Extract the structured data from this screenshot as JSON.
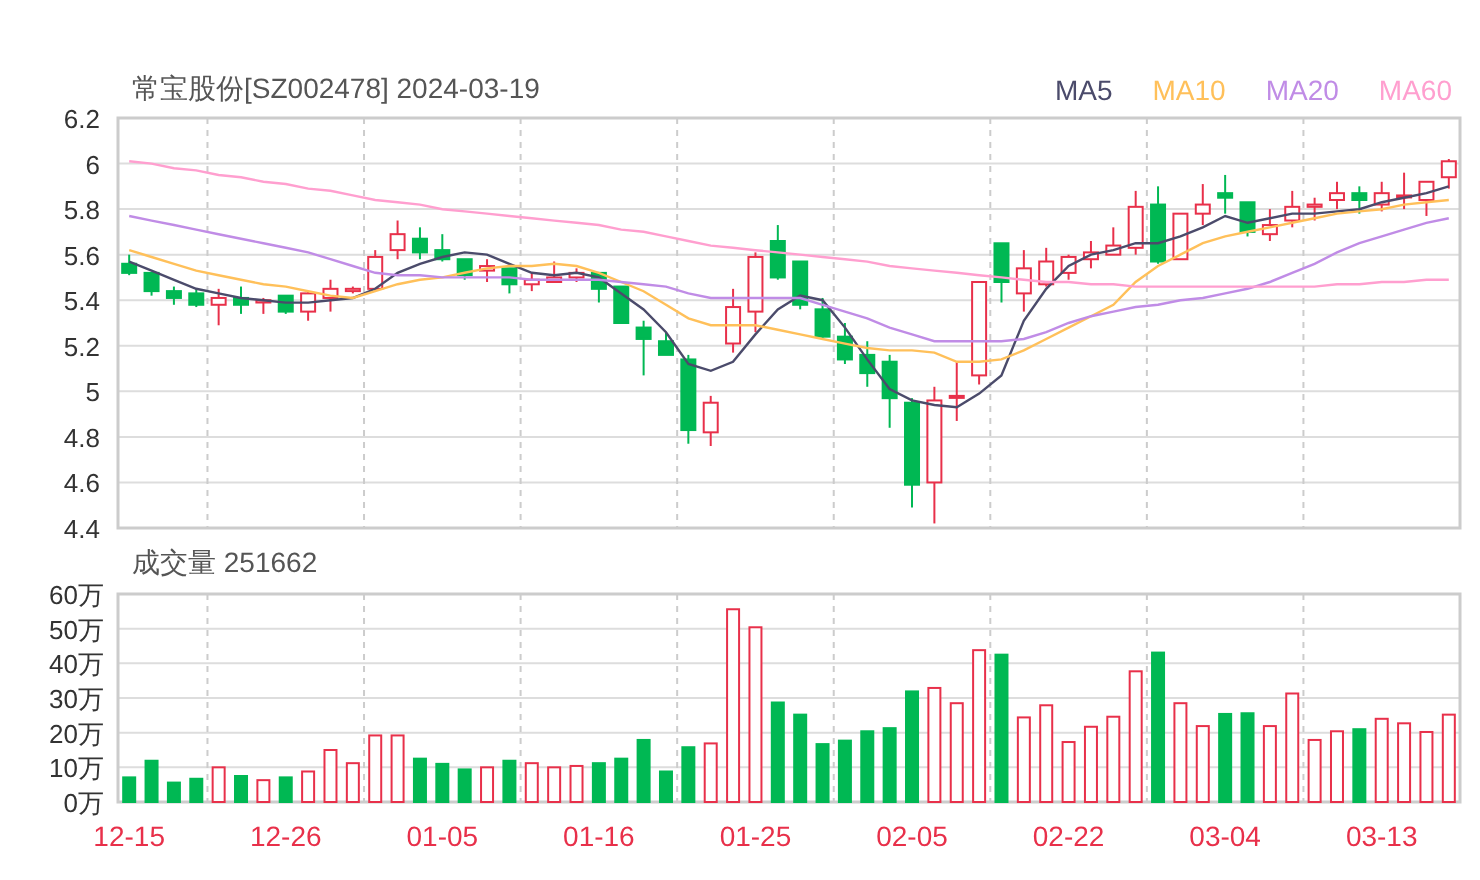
{
  "title": "常宝股份[SZ002478] 2024-03-19",
  "price_chart": {
    "chart_data": {
      "type": "candlestick",
      "grid": true,
      "ylim": [
        4.4,
        6.2
      ],
      "yticks": [
        4.4,
        4.6,
        4.8,
        5,
        5.2,
        5.4,
        5.6,
        5.8,
        6,
        6.2
      ],
      "categories": [
        null,
        null,
        null,
        null,
        null,
        null,
        null,
        null,
        null,
        null,
        null,
        null,
        null,
        null,
        null,
        null,
        null,
        null,
        null,
        null,
        null,
        null,
        null,
        null,
        null,
        null,
        null,
        null,
        null,
        null,
        null,
        null,
        null,
        null,
        null,
        null,
        null,
        null,
        null,
        null,
        null,
        null,
        null,
        null,
        null,
        null,
        null,
        null,
        null,
        null,
        null,
        null,
        null,
        null,
        null,
        null,
        null,
        null,
        null,
        null
      ],
      "series": [
        {
          "name": "MA5",
          "type": "line",
          "color": "#4b4b6b",
          "values": [
            5.57,
            5.53,
            5.49,
            5.45,
            5.43,
            5.41,
            5.4,
            5.39,
            5.39,
            5.4,
            5.41,
            5.45,
            5.52,
            5.56,
            5.59,
            5.61,
            5.6,
            5.56,
            5.52,
            5.51,
            5.52,
            5.5,
            5.43,
            5.36,
            5.26,
            5.12,
            5.09,
            5.13,
            5.25,
            5.36,
            5.42,
            5.4,
            5.28,
            5.14,
            5.01,
            4.96,
            4.94,
            4.93,
            4.99,
            5.07,
            5.31,
            5.45,
            5.55,
            5.6,
            5.62,
            5.65,
            5.65,
            5.68,
            5.72,
            5.77,
            5.74,
            5.76,
            5.78,
            5.78,
            5.79,
            5.8,
            5.83,
            5.85,
            5.87,
            5.9
          ]
        },
        {
          "name": "MA10",
          "type": "line",
          "color": "#ffc05a",
          "values": [
            5.62,
            5.59,
            5.56,
            5.53,
            5.51,
            5.49,
            5.47,
            5.46,
            5.44,
            5.42,
            5.41,
            5.44,
            5.47,
            5.49,
            5.5,
            5.52,
            5.54,
            5.55,
            5.55,
            5.56,
            5.55,
            5.52,
            5.48,
            5.44,
            5.38,
            5.32,
            5.29,
            5.29,
            5.29,
            5.27,
            5.25,
            5.23,
            5.21,
            5.19,
            5.18,
            5.18,
            5.17,
            5.13,
            5.13,
            5.14,
            5.18,
            5.23,
            5.28,
            5.33,
            5.38,
            5.48,
            5.55,
            5.6,
            5.65,
            5.68,
            5.7,
            5.72,
            5.74,
            5.76,
            5.78,
            5.79,
            5.8,
            5.82,
            5.83,
            5.84
          ]
        },
        {
          "name": "MA20",
          "type": "line",
          "color": "#c08ce6",
          "values": [
            5.77,
            5.75,
            5.73,
            5.71,
            5.69,
            5.67,
            5.65,
            5.63,
            5.61,
            5.58,
            5.55,
            5.52,
            5.51,
            5.51,
            5.5,
            5.5,
            5.5,
            5.5,
            5.49,
            5.49,
            5.49,
            5.49,
            5.48,
            5.47,
            5.46,
            5.43,
            5.41,
            5.41,
            5.41,
            5.41,
            5.41,
            5.38,
            5.35,
            5.32,
            5.28,
            5.25,
            5.22,
            5.22,
            5.22,
            5.22,
            5.23,
            5.26,
            5.3,
            5.33,
            5.35,
            5.37,
            5.38,
            5.4,
            5.41,
            5.43,
            5.45,
            5.48,
            5.52,
            5.56,
            5.61,
            5.65,
            5.68,
            5.71,
            5.74,
            5.76
          ]
        },
        {
          "name": "MA60",
          "type": "line",
          "color": "#ff9fcf",
          "values": [
            6.01,
            6.0,
            5.98,
            5.97,
            5.95,
            5.94,
            5.92,
            5.91,
            5.89,
            5.88,
            5.86,
            5.84,
            5.83,
            5.82,
            5.8,
            5.79,
            5.78,
            5.77,
            5.76,
            5.75,
            5.74,
            5.73,
            5.71,
            5.7,
            5.68,
            5.66,
            5.64,
            5.63,
            5.62,
            5.61,
            5.6,
            5.59,
            5.58,
            5.57,
            5.55,
            5.54,
            5.53,
            5.52,
            5.51,
            5.5,
            5.49,
            5.48,
            5.48,
            5.47,
            5.47,
            5.46,
            5.46,
            5.46,
            5.46,
            5.46,
            5.46,
            5.46,
            5.46,
            5.46,
            5.47,
            5.47,
            5.48,
            5.48,
            5.49,
            5.49
          ]
        }
      ],
      "ohlc": [
        [
          5.56,
          5.6,
          5.51,
          5.52
        ],
        [
          5.52,
          5.52,
          5.42,
          5.44
        ],
        [
          5.44,
          5.46,
          5.38,
          5.41
        ],
        [
          5.43,
          5.45,
          5.37,
          5.38
        ],
        [
          5.38,
          5.45,
          5.29,
          5.41
        ],
        [
          5.41,
          5.46,
          5.34,
          5.38
        ],
        [
          5.39,
          5.41,
          5.34,
          5.4
        ],
        [
          5.42,
          5.42,
          5.34,
          5.35
        ],
        [
          5.35,
          5.44,
          5.31,
          5.43
        ],
        [
          5.41,
          5.49,
          5.35,
          5.45
        ],
        [
          5.44,
          5.46,
          5.43,
          5.45
        ],
        [
          5.45,
          5.62,
          5.44,
          5.59
        ],
        [
          5.62,
          5.75,
          5.58,
          5.69
        ],
        [
          5.67,
          5.72,
          5.58,
          5.61
        ],
        [
          5.62,
          5.69,
          5.57,
          5.58
        ],
        [
          5.58,
          5.58,
          5.49,
          5.51
        ],
        [
          5.53,
          5.58,
          5.48,
          5.55
        ],
        [
          5.54,
          5.54,
          5.43,
          5.47
        ],
        [
          5.47,
          5.52,
          5.44,
          5.49
        ],
        [
          5.48,
          5.57,
          5.48,
          5.5
        ],
        [
          5.5,
          5.54,
          5.48,
          5.52
        ],
        [
          5.52,
          5.52,
          5.39,
          5.45
        ],
        [
          5.46,
          5.46,
          5.3,
          5.3
        ],
        [
          5.28,
          5.31,
          5.07,
          5.23
        ],
        [
          5.22,
          5.26,
          5.16,
          5.16
        ],
        [
          5.14,
          5.16,
          4.77,
          4.83
        ],
        [
          4.82,
          4.98,
          4.76,
          4.95
        ],
        [
          5.21,
          5.45,
          5.17,
          5.37
        ],
        [
          5.35,
          5.61,
          5.26,
          5.59
        ],
        [
          5.66,
          5.73,
          5.49,
          5.5
        ],
        [
          5.57,
          5.57,
          5.36,
          5.38
        ],
        [
          5.36,
          5.41,
          5.23,
          5.24
        ],
        [
          5.24,
          5.3,
          5.12,
          5.14
        ],
        [
          5.16,
          5.22,
          5.02,
          5.08
        ],
        [
          5.13,
          5.16,
          4.84,
          4.97
        ],
        [
          4.95,
          4.97,
          4.49,
          4.59
        ],
        [
          4.6,
          5.02,
          4.42,
          4.96
        ],
        [
          4.98,
          5.13,
          4.87,
          4.98
        ],
        [
          5.07,
          5.48,
          5.03,
          5.48
        ],
        [
          5.65,
          5.65,
          5.39,
          5.48
        ],
        [
          5.43,
          5.62,
          5.35,
          5.54
        ],
        [
          5.47,
          5.63,
          5.46,
          5.57
        ],
        [
          5.52,
          5.6,
          5.49,
          5.59
        ],
        [
          5.58,
          5.66,
          5.54,
          5.61
        ],
        [
          5.6,
          5.72,
          5.6,
          5.64
        ],
        [
          5.63,
          5.88,
          5.6,
          5.81
        ],
        [
          5.82,
          5.9,
          5.56,
          5.57
        ],
        [
          5.58,
          5.78,
          5.58,
          5.78
        ],
        [
          5.78,
          5.91,
          5.73,
          5.82
        ],
        [
          5.87,
          5.95,
          5.78,
          5.85
        ],
        [
          5.83,
          5.83,
          5.68,
          5.7
        ],
        [
          5.69,
          5.8,
          5.66,
          5.73
        ],
        [
          5.75,
          5.88,
          5.72,
          5.81
        ],
        [
          5.81,
          5.85,
          5.75,
          5.82
        ],
        [
          5.84,
          5.92,
          5.8,
          5.87
        ],
        [
          5.87,
          5.9,
          5.78,
          5.84
        ],
        [
          5.82,
          5.92,
          5.79,
          5.87
        ],
        [
          5.86,
          5.96,
          5.8,
          5.86
        ],
        [
          5.84,
          5.92,
          5.77,
          5.92
        ],
        [
          5.94,
          6.02,
          5.89,
          6.01
        ]
      ]
    }
  },
  "volume_chart": {
    "title": "成交量 251662",
    "chart_data": {
      "type": "bar",
      "ylim": [
        0,
        60
      ],
      "yticks": [
        {
          "value": 0,
          "label": "0万"
        },
        {
          "value": 10,
          "label": "10万"
        },
        {
          "value": 20,
          "label": "20万"
        },
        {
          "value": 30,
          "label": "30万"
        },
        {
          "value": 40,
          "label": "40万"
        },
        {
          "value": 50,
          "label": "50万"
        },
        {
          "value": 60,
          "label": "60万"
        }
      ],
      "grid": true,
      "categories": [
        "12-15",
        null,
        null,
        null,
        null,
        null,
        null,
        "12-26",
        null,
        null,
        null,
        null,
        null,
        null,
        "01-05",
        null,
        null,
        null,
        null,
        null,
        null,
        "01-16",
        null,
        null,
        null,
        null,
        null,
        null,
        "01-25",
        null,
        null,
        null,
        null,
        null,
        null,
        "02-05",
        null,
        null,
        null,
        null,
        null,
        null,
        "02-22",
        null,
        null,
        null,
        null,
        null,
        null,
        "03-04",
        null,
        null,
        null,
        null,
        null,
        null,
        "03-13",
        null,
        null,
        null
      ],
      "values": [
        7.1,
        11.9,
        5.6,
        6.7,
        10,
        7.5,
        6.3,
        7.1,
        8.8,
        15,
        11.2,
        19.2,
        19.2,
        12.5,
        11,
        9.4,
        10,
        11.9,
        11.2,
        10,
        10.4,
        11.2,
        12.5,
        17.9,
        8.8,
        15.8,
        16.9,
        55.6,
        50.4,
        28.7,
        25.2,
        16.7,
        17.7,
        20.4,
        21.3,
        31.9,
        32.9,
        28.5,
        43.8,
        42.5,
        24.4,
        27.9,
        17.3,
        21.7,
        24.6,
        37.7,
        43.1,
        28.5,
        21.9,
        25.4,
        25.6,
        21.9,
        31.3,
        17.9,
        20.4,
        21,
        24,
        22.7,
        20.2,
        25.2
      ]
    }
  }
}
